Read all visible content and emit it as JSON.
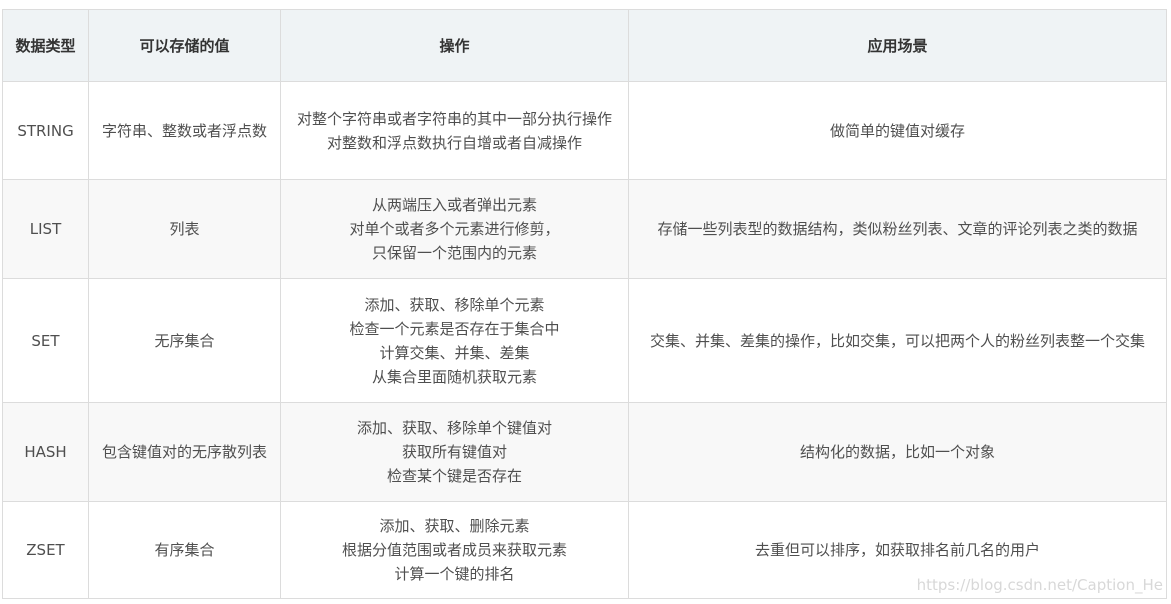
{
  "table": {
    "headers": [
      "数据类型",
      "可以存储的值",
      "操作",
      "应用场景"
    ],
    "rows": [
      {
        "type": "STRING",
        "value": "字符串、整数或者浮点数",
        "ops": [
          "对整个字符串或者字符串的其中一部分执行操作",
          "对整数和浮点数执行自增或者自减操作"
        ],
        "scene": "做简单的键值对缓存"
      },
      {
        "type": "LIST",
        "value": "列表",
        "ops": [
          "从两端压入或者弹出元素",
          "对单个或者多个元素进行修剪，",
          "只保留一个范围内的元素"
        ],
        "scene": "存储一些列表型的数据结构，类似粉丝列表、文章的评论列表之类的数据"
      },
      {
        "type": "SET",
        "value": "无序集合",
        "ops": [
          "添加、获取、移除单个元素",
          "检查一个元素是否存在于集合中",
          "计算交集、并集、差集",
          "从集合里面随机获取元素"
        ],
        "scene": "交集、并集、差集的操作，比如交集，可以把两个人的粉丝列表整一个交集"
      },
      {
        "type": "HASH",
        "value": "包含键值对的无序散列表",
        "ops": [
          "添加、获取、移除单个键值对",
          "获取所有键值对",
          "检查某个键是否存在"
        ],
        "scene": "结构化的数据，比如一个对象"
      },
      {
        "type": "ZSET",
        "value": "有序集合",
        "ops": [
          "添加、获取、删除元素",
          "根据分值范围或者成员来获取元素",
          "计算一个键的排名"
        ],
        "scene": "去重但可以排序，如获取排名前几名的用户"
      }
    ]
  },
  "watermark": "https://blog.csdn.net/Caption_He"
}
